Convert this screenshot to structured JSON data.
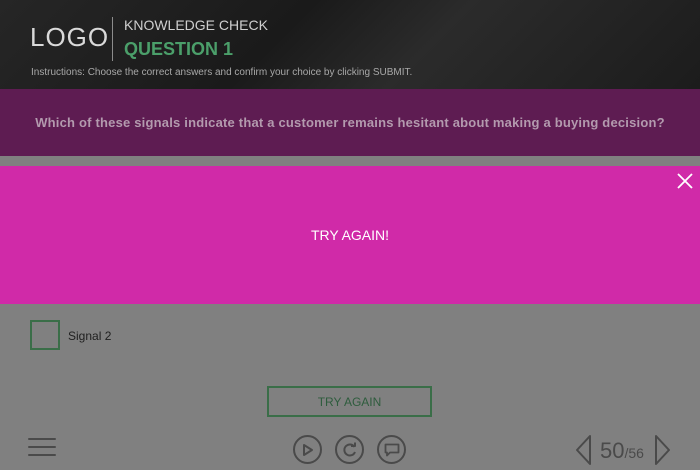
{
  "header": {
    "logo": "LOGO",
    "kc_title": "KNOWLEDGE CHECK",
    "question_number": "QUESTION 1",
    "instructions": "Instructions: Choose the correct answers and confirm your choice by clicking SUBMIT."
  },
  "question": {
    "text": "Which of these signals indicate that a customer remains hesitant about making a buying decision?"
  },
  "options": [
    {
      "label": "Signal 2",
      "checked": false
    }
  ],
  "buttons": {
    "try_again": "TRY AGAIN"
  },
  "feedback": {
    "message": "TRY AGAIN!",
    "close_icon": "close-icon"
  },
  "footer": {
    "page_current": "50",
    "page_total": "/56",
    "icons": [
      "menu-icon",
      "play-icon",
      "replay-icon",
      "chat-icon",
      "prev-arrow-icon",
      "next-arrow-icon"
    ]
  },
  "colors": {
    "header_bg": "#1f1f1f",
    "question_band": "#5e1c52",
    "feedback_bg": "#d02aa8",
    "accent_green": "#4b9f6a",
    "content_bg": "#808080"
  }
}
